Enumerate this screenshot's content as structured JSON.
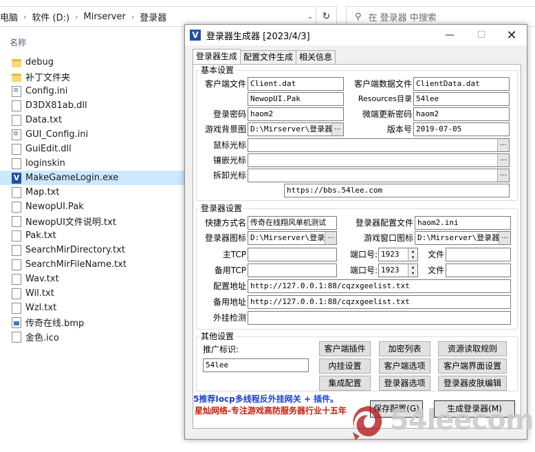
{
  "explorer": {
    "breadcrumb": [
      "电脑",
      "软件 (D:)",
      "Mirserver",
      "登录器"
    ],
    "search_placeholder": "在 登录器 中搜索",
    "column_header": "名称",
    "files": [
      {
        "name": "debug",
        "icon": "folder-icon"
      },
      {
        "name": "补丁文件夹",
        "icon": "folder-icon"
      },
      {
        "name": "Config.ini",
        "icon": "config-file-icon"
      },
      {
        "name": "D3DX81ab.dll",
        "icon": "file-icon"
      },
      {
        "name": "Data.txt",
        "icon": "file-icon"
      },
      {
        "name": "GUI_Config.ini",
        "icon": "config-file-icon"
      },
      {
        "name": "GuiEdit.dll",
        "icon": "file-icon"
      },
      {
        "name": "loginskin",
        "icon": "file-icon"
      },
      {
        "name": "MakeGameLogin.exe",
        "icon": "exe-icon",
        "selected": true
      },
      {
        "name": "Map.txt",
        "icon": "file-icon"
      },
      {
        "name": "NewopUI.Pak",
        "icon": "file-icon"
      },
      {
        "name": "NewopUI文件说明.txt",
        "icon": "file-icon"
      },
      {
        "name": "Pak.txt",
        "icon": "file-icon"
      },
      {
        "name": "SearchMirDirectory.txt",
        "icon": "file-icon"
      },
      {
        "name": "SearchMirFileName.txt",
        "icon": "file-icon"
      },
      {
        "name": "Wav.txt",
        "icon": "file-icon"
      },
      {
        "name": "Wil.txt",
        "icon": "file-icon"
      },
      {
        "name": "Wzl.txt",
        "icon": "file-icon"
      },
      {
        "name": "传奇在线.bmp",
        "icon": "bitmap-icon"
      },
      {
        "name": "金色.ico",
        "icon": "ico-file-icon"
      }
    ]
  },
  "dialog": {
    "title": "登录器生成器 [2023/4/3]",
    "app_icon_letter": "V",
    "tabs": [
      "登录器生成",
      "配置文件生成",
      "相关信息"
    ],
    "basic": {
      "legend": "基本设置",
      "client_file_label": "客户端文件",
      "client_file": "Client.dat",
      "client_data_label": "客户端数据文件",
      "client_data": "ClientData.dat",
      "pak_file": "NewopUI.Pak",
      "resources_label": "Resources目录",
      "resources": "54lee",
      "login_pwd_label": "登录密码",
      "login_pwd": "haom2",
      "update_pwd_label": "微端更新密码",
      "update_pwd": "haom2",
      "bg_label": "游戏背景图",
      "bg_path": "D:\\Mirserver\\登录器\\",
      "version_label": "版本号",
      "version": "2019-07-05",
      "cursor_label": "鼠标光标",
      "inlay_label": "镶嵌光标",
      "remove_label": "拆卸光标",
      "url": "https://bbs.54lee.com",
      "browse": "..."
    },
    "launcher": {
      "legend": "登录器设置",
      "shortcut_label": "快捷方式名",
      "shortcut": "传奇在线翔风单机测试",
      "cfg_label": "登录器配置文件",
      "cfg": "haom2.ini",
      "icon_label": "登录器图标",
      "icon_path": "D:\\Mirserver\\登录器",
      "game_icon_label": "游戏窗口图标",
      "game_icon_path": "D:\\Mirserver\\登录器\\:",
      "main_tcp_label": "主TCP",
      "backup_tcp_label": "备用TCP",
      "port_label": "端口号:",
      "port1": "1923",
      "port2": "1923",
      "file_label": "文件",
      "cfg_addr_label": "配置地址",
      "cfg_addr": "http://127.0.0.1:88/cqzxgeelist.txt",
      "backup_addr_label": "备用地址",
      "backup_addr": "http://127.0.0.1:88/cqzxgeelist.txt",
      "plugin_check_label": "外挂检测"
    },
    "other": {
      "legend": "其他设置",
      "promo_label": "推广标识:",
      "promo_value": "54lee",
      "buttons": [
        "客户端插件",
        "加密列表",
        "资源读取规则",
        "内挂设置",
        "客户端选项",
        "客户端界面设置",
        "集成配置",
        "登录器选项",
        "登录器皮肤编辑"
      ]
    },
    "promo_text_1": "5推荐Iocp多线程反外挂网关 + 插件。",
    "promo_text_2": "星灿网络-专注游戏高防服务器行业十五年",
    "save_button": "保存配置(G)",
    "generate_button": "生成登录器(M)"
  },
  "watermark": "54leecom",
  "colors": {
    "promo_blue": "#1a3fd0",
    "promo_red": "#d4160c",
    "selection": "#cce8ff",
    "dialog_bg": "#f0f0f0"
  }
}
